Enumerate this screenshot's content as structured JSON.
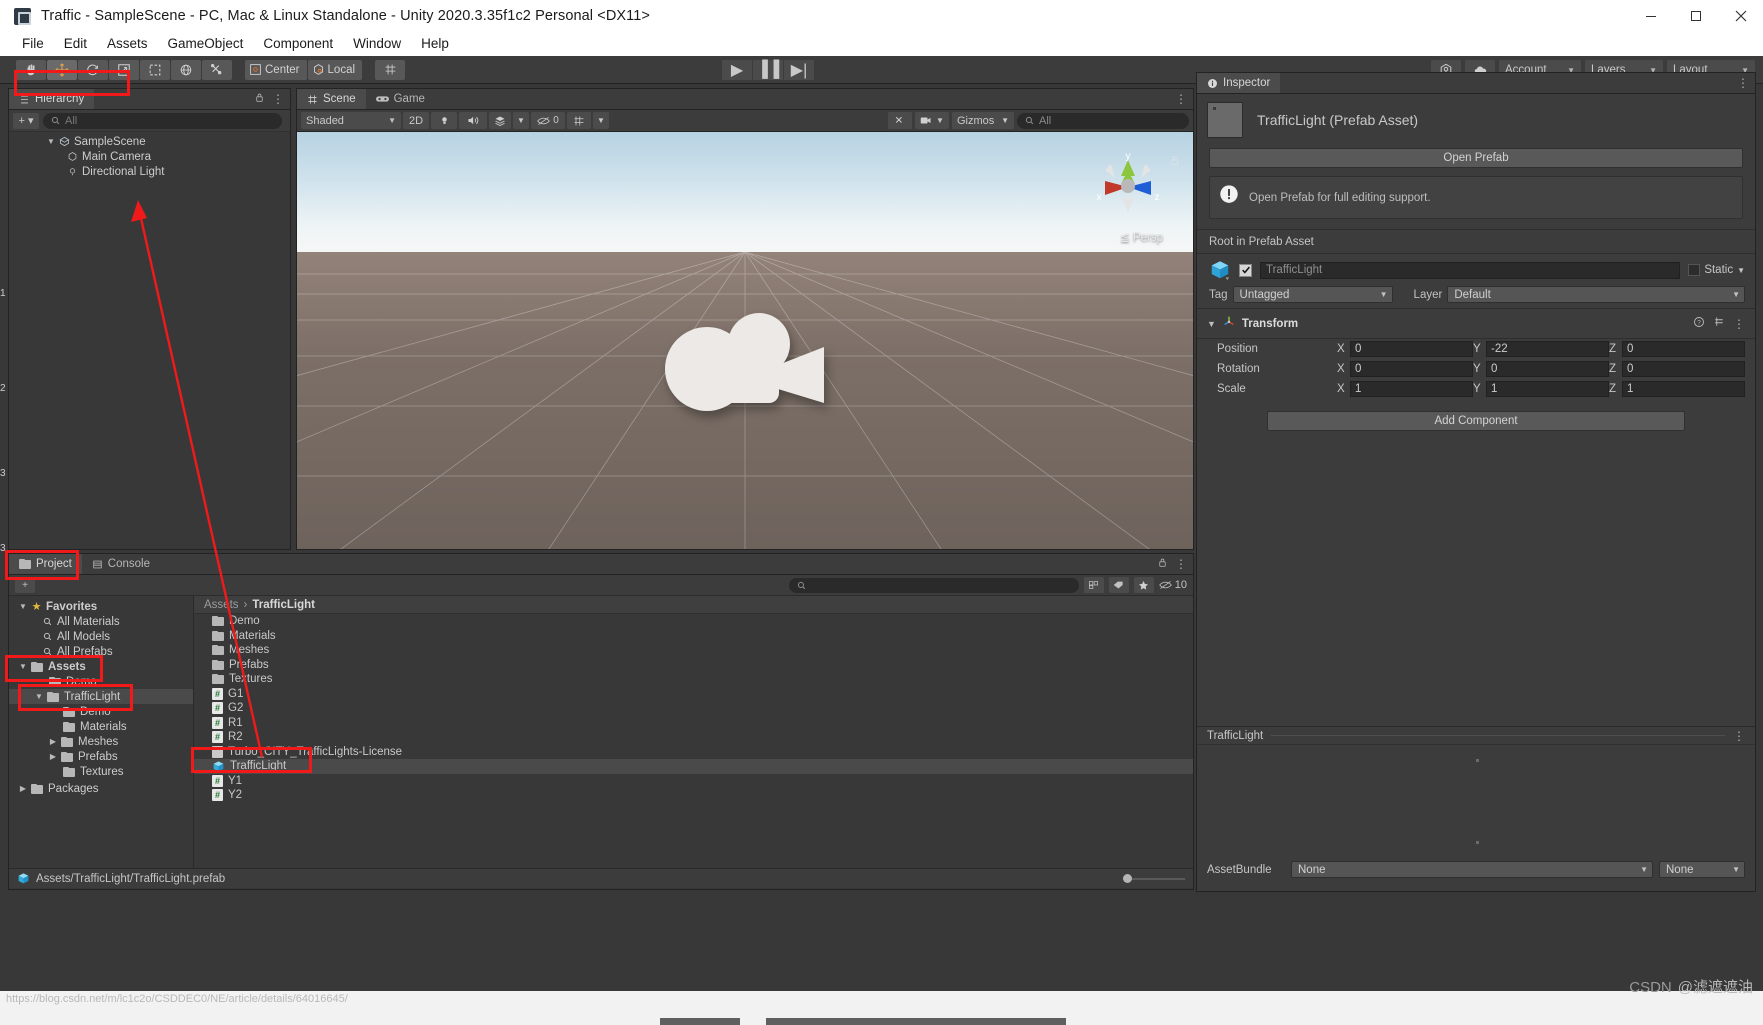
{
  "window": {
    "title": "Traffic - SampleScene - PC, Mac & Linux Standalone - Unity 2020.3.35f1c2 Personal <DX11>",
    "minimize": "–",
    "maximize": "☐",
    "close": "✕"
  },
  "menubar": [
    "File",
    "Edit",
    "Assets",
    "GameObject",
    "Component",
    "Window",
    "Help"
  ],
  "toolbar": {
    "tools": [
      "hand-tool",
      "move-tool",
      "rotate-tool",
      "scale-tool",
      "rect-tool",
      "transform-tool",
      "custom-tool"
    ],
    "pivot_mode": "Center",
    "pivot_rotation": "Local",
    "play": "▶",
    "pause": "▐▐",
    "step": "▶|",
    "account": "Account",
    "layers": "Layers",
    "layout": "Layout"
  },
  "hierarchy": {
    "tab": "Hierarchy",
    "add_label": "+ ▾",
    "search_placeholder": "All",
    "items": [
      {
        "label": "SampleScene",
        "depth": 0,
        "icon": "scene-icon",
        "expanded": true
      },
      {
        "label": "Main Camera",
        "depth": 1,
        "icon": "gameobject-icon"
      },
      {
        "label": "Directional Light",
        "depth": 1,
        "icon": "light-icon"
      }
    ]
  },
  "scene": {
    "tabs": [
      {
        "label": "Scene",
        "icon": "scene-grid-icon",
        "selected": true
      },
      {
        "label": "Game",
        "icon": "gamepad-icon",
        "selected": false
      }
    ],
    "draw_mode": "Shaded",
    "two_d": "2D",
    "effects_count": "0",
    "gizmos": "Gizmos",
    "search_placeholder": "All",
    "gizmo_axes": {
      "x": "x",
      "y": "y",
      "z": "z"
    },
    "projection": "≦ Persp"
  },
  "inspector": {
    "tab": "Inspector",
    "asset_title": "TrafficLight (Prefab Asset)",
    "open_prefab_button": "Open Prefab",
    "help_message": "Open Prefab for full editing support.",
    "root_section_label": "Root in Prefab Asset",
    "object_name": "TrafficLight",
    "static_label": "Static",
    "tag_label": "Tag",
    "tag_value": "Untagged",
    "layer_label": "Layer",
    "layer_value": "Default",
    "transform": {
      "title": "Transform",
      "rows": [
        {
          "label": "Position",
          "x": "0",
          "y": "-22",
          "z": "0"
        },
        {
          "label": "Rotation",
          "x": "0",
          "y": "0",
          "z": "0"
        },
        {
          "label": "Scale",
          "x": "1",
          "y": "1",
          "z": "1"
        }
      ],
      "axis_labels": {
        "x": "X",
        "y": "Y",
        "z": "Z"
      }
    },
    "add_component_button": "Add Component",
    "preview_title": "TrafficLight",
    "assetbundle_label": "AssetBundle",
    "assetbundle_value": "None",
    "assetbundle_variant": "None"
  },
  "project": {
    "tabs": [
      {
        "label": "Project",
        "icon": "folder-icon",
        "selected": true
      },
      {
        "label": "Console",
        "icon": "console-icon",
        "selected": false
      }
    ],
    "search_placeholder": "",
    "filter_count": "10",
    "tree": [
      {
        "label": "Favorites",
        "depth": 0,
        "icon": "star-icon",
        "expanded": true
      },
      {
        "label": "All Materials",
        "depth": 1,
        "icon": "search-icon"
      },
      {
        "label": "All Models",
        "depth": 1,
        "icon": "search-icon"
      },
      {
        "label": "All Prefabs",
        "depth": 1,
        "icon": "search-icon"
      },
      {
        "label": "Assets",
        "depth": 0,
        "icon": "folder-icon",
        "expanded": true
      },
      {
        "label": "Demo",
        "depth": 1,
        "icon": "folder-icon"
      },
      {
        "label": "TrafficLight",
        "depth": 1,
        "icon": "folder-icon",
        "expanded": true,
        "selected": true
      },
      {
        "label": "Demo",
        "depth": 2,
        "icon": "folder-icon"
      },
      {
        "label": "Materials",
        "depth": 2,
        "icon": "folder-icon"
      },
      {
        "label": "Meshes",
        "depth": 2,
        "icon": "folder-icon",
        "expandable": true
      },
      {
        "label": "Prefabs",
        "depth": 2,
        "icon": "folder-icon",
        "expandable": true
      },
      {
        "label": "Textures",
        "depth": 2,
        "icon": "folder-icon"
      },
      {
        "label": "Packages",
        "depth": 0,
        "icon": "folder-icon"
      }
    ],
    "breadcrumb": {
      "root": "Assets",
      "separator": "›",
      "current": "TrafficLight"
    },
    "files": [
      {
        "label": "Demo",
        "type": "folder"
      },
      {
        "label": "Materials",
        "type": "folder"
      },
      {
        "label": "Meshes",
        "type": "folder"
      },
      {
        "label": "Prefabs",
        "type": "folder"
      },
      {
        "label": "Textures",
        "type": "folder"
      },
      {
        "label": "G1",
        "type": "script"
      },
      {
        "label": "G2",
        "type": "script"
      },
      {
        "label": "R1",
        "type": "script"
      },
      {
        "label": "R2",
        "type": "script"
      },
      {
        "label": "Turbo_CITY_TrafficLights-License",
        "type": "license"
      },
      {
        "label": "TrafficLight",
        "type": "prefab",
        "selected": true
      },
      {
        "label": "Y1",
        "type": "script"
      },
      {
        "label": "Y2",
        "type": "script"
      }
    ],
    "status_path": "Assets/TrafficLight/TrafficLight.prefab"
  },
  "watermark": {
    "csdn": "CSDN",
    "author": "@滤遮遮油",
    "url": "https://blog.csdn.net/m/lc1c2o/CSDDEC0/NE/article/details/64016645/"
  },
  "colors": {
    "accent_red": "#f01a1a",
    "panel_bg": "#383838",
    "toolbar_bg": "#3c3c3c",
    "selection": "#4a4a4a",
    "prefab_blue": "#4ec3f0",
    "script_green": "#1f7a34"
  }
}
